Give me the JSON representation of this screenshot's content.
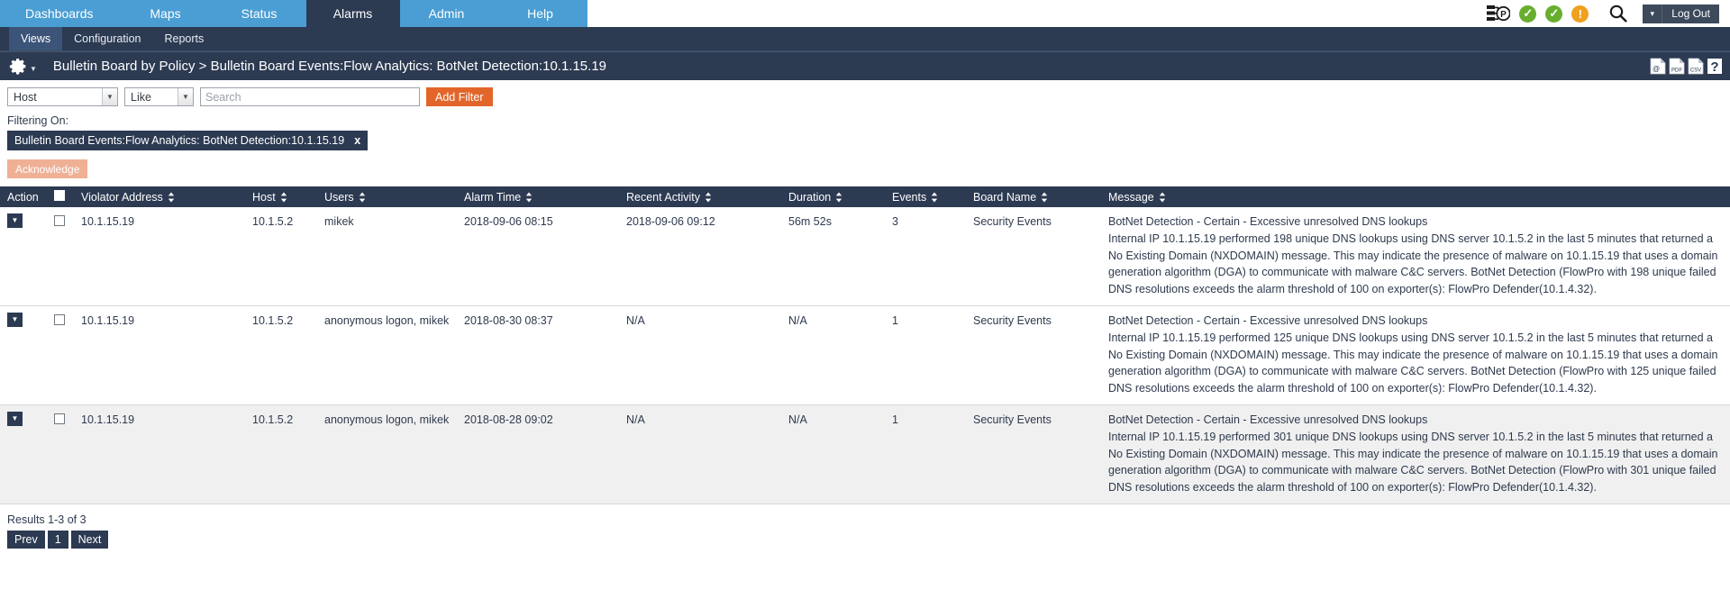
{
  "topnav": {
    "items": [
      {
        "label": "Dashboards",
        "active": false
      },
      {
        "label": "Maps",
        "active": false
      },
      {
        "label": "Status",
        "active": false
      },
      {
        "label": "Alarms",
        "active": true
      },
      {
        "label": "Admin",
        "active": false
      },
      {
        "label": "Help",
        "active": false
      }
    ],
    "status_icons": [
      {
        "name": "policy-server-icon",
        "glyph": "P"
      },
      {
        "name": "status-ok-icon-1",
        "glyph": "✓",
        "color": "#68ae2e"
      },
      {
        "name": "status-ok-icon-2",
        "glyph": "✓",
        "color": "#68ae2e"
      },
      {
        "name": "status-warning-icon",
        "glyph": "!",
        "color": "#f0a01e"
      }
    ],
    "search_icon": "search-icon",
    "logout_label": "Log Out",
    "logout_caret": "▾"
  },
  "subnav": {
    "items": [
      {
        "label": "Views",
        "active": true
      },
      {
        "label": "Configuration",
        "active": false
      },
      {
        "label": "Reports",
        "active": false
      }
    ]
  },
  "titlebar": {
    "gear_icon": "gear-icon",
    "breadcrumb": "Bulletin Board by Policy > Bulletin Board Events:Flow Analytics: BotNet Detection:10.1.15.19",
    "export_icons": [
      {
        "name": "email-export-icon",
        "label": "@"
      },
      {
        "name": "pdf-export-icon",
        "label": "PDF"
      },
      {
        "name": "csv-export-icon",
        "label": "CSV"
      }
    ],
    "help_icon_label": "?"
  },
  "filterbar": {
    "field_select": {
      "value": "Host",
      "options": [
        "Host"
      ]
    },
    "operator_select": {
      "value": "Like",
      "options": [
        "Like"
      ]
    },
    "search": {
      "value": "",
      "placeholder": "Search"
    },
    "add_filter_label": "Add Filter",
    "add_filter_color": "#e2662a"
  },
  "filtering": {
    "label": "Filtering On:",
    "chips": [
      {
        "text": "Bulletin Board Events:Flow Analytics: BotNet Detection:10.1.15.19",
        "remove": "x"
      }
    ]
  },
  "actions": {
    "acknowledge_label": "Acknowledge",
    "acknowledge_color": "#efb096"
  },
  "table": {
    "columns": [
      {
        "label": "Action",
        "sortable": false
      },
      {
        "label": "",
        "sortable": false
      },
      {
        "label": "Violator Address",
        "sortable": true
      },
      {
        "label": "Host",
        "sortable": true
      },
      {
        "label": "Users",
        "sortable": true
      },
      {
        "label": "Alarm Time",
        "sortable": true
      },
      {
        "label": "Recent Activity",
        "sortable": true
      },
      {
        "label": "Duration",
        "sortable": true
      },
      {
        "label": "Events",
        "sortable": true
      },
      {
        "label": "Board Name",
        "sortable": true
      },
      {
        "label": "Message",
        "sortable": true
      }
    ],
    "rows": [
      {
        "violator_address": "10.1.15.19",
        "host": "10.1.5.2",
        "users": "mikek",
        "alarm_time": "2018-09-06 08:15",
        "recent_activity": "2018-09-06 09:12",
        "duration": "56m 52s",
        "events": "3",
        "board_name": "Security Events",
        "message_title": "BotNet Detection - Certain - Excessive unresolved DNS lookups",
        "message_body": "Internal IP 10.1.15.19 performed 198 unique DNS lookups using DNS server 10.1.5.2 in the last 5 minutes that returned a No Existing Domain (NXDOMAIN) message. This may indicate the presence of malware on 10.1.15.19 that uses a domain generation algorithm (DGA) to communicate with malware C&C servers. BotNet Detection (FlowPro with 198 unique failed DNS resolutions exceeds the alarm threshold of 100 on exporter(s): FlowPro Defender(10.1.4.32)."
      },
      {
        "violator_address": "10.1.15.19",
        "host": "10.1.5.2",
        "users": "anonymous logon, mikek",
        "alarm_time": "2018-08-30 08:37",
        "recent_activity": "N/A",
        "duration": "N/A",
        "events": "1",
        "board_name": "Security Events",
        "message_title": "BotNet Detection - Certain - Excessive unresolved DNS lookups",
        "message_body": "Internal IP 10.1.15.19 performed 125 unique DNS lookups using DNS server 10.1.5.2 in the last 5 minutes that returned a No Existing Domain (NXDOMAIN) message. This may indicate the presence of malware on 10.1.15.19 that uses a domain generation algorithm (DGA) to communicate with malware C&C servers. BotNet Detection (FlowPro with 125 unique failed DNS resolutions exceeds the alarm threshold of 100 on exporter(s): FlowPro Defender(10.1.4.32)."
      },
      {
        "violator_address": "10.1.15.19",
        "host": "10.1.5.2",
        "users": "anonymous logon, mikek",
        "alarm_time": "2018-08-28 09:02",
        "recent_activity": "N/A",
        "duration": "N/A",
        "events": "1",
        "board_name": "Security Events",
        "message_title": "BotNet Detection - Certain - Excessive unresolved DNS lookups",
        "message_body": "Internal IP 10.1.15.19 performed 301 unique DNS lookups using DNS server 10.1.5.2 in the last 5 minutes that returned a No Existing Domain (NXDOMAIN) message. This may indicate the presence of malware on 10.1.15.19 that uses a domain generation algorithm (DGA) to communicate with malware C&C servers. BotNet Detection (FlowPro with 301 unique failed DNS resolutions exceeds the alarm threshold of 100 on exporter(s): FlowPro Defender(10.1.4.32)."
      }
    ]
  },
  "footer": {
    "results_text": "Results 1-3 of 3",
    "prev_label": "Prev",
    "page_label": "1",
    "next_label": "Next"
  },
  "colors": {
    "nav_blue": "#4a9ed4",
    "dark_navy": "#2c3a52",
    "accent_orange": "#e2662a",
    "ok_green": "#68ae2e",
    "warn_orange": "#f0a01e"
  }
}
